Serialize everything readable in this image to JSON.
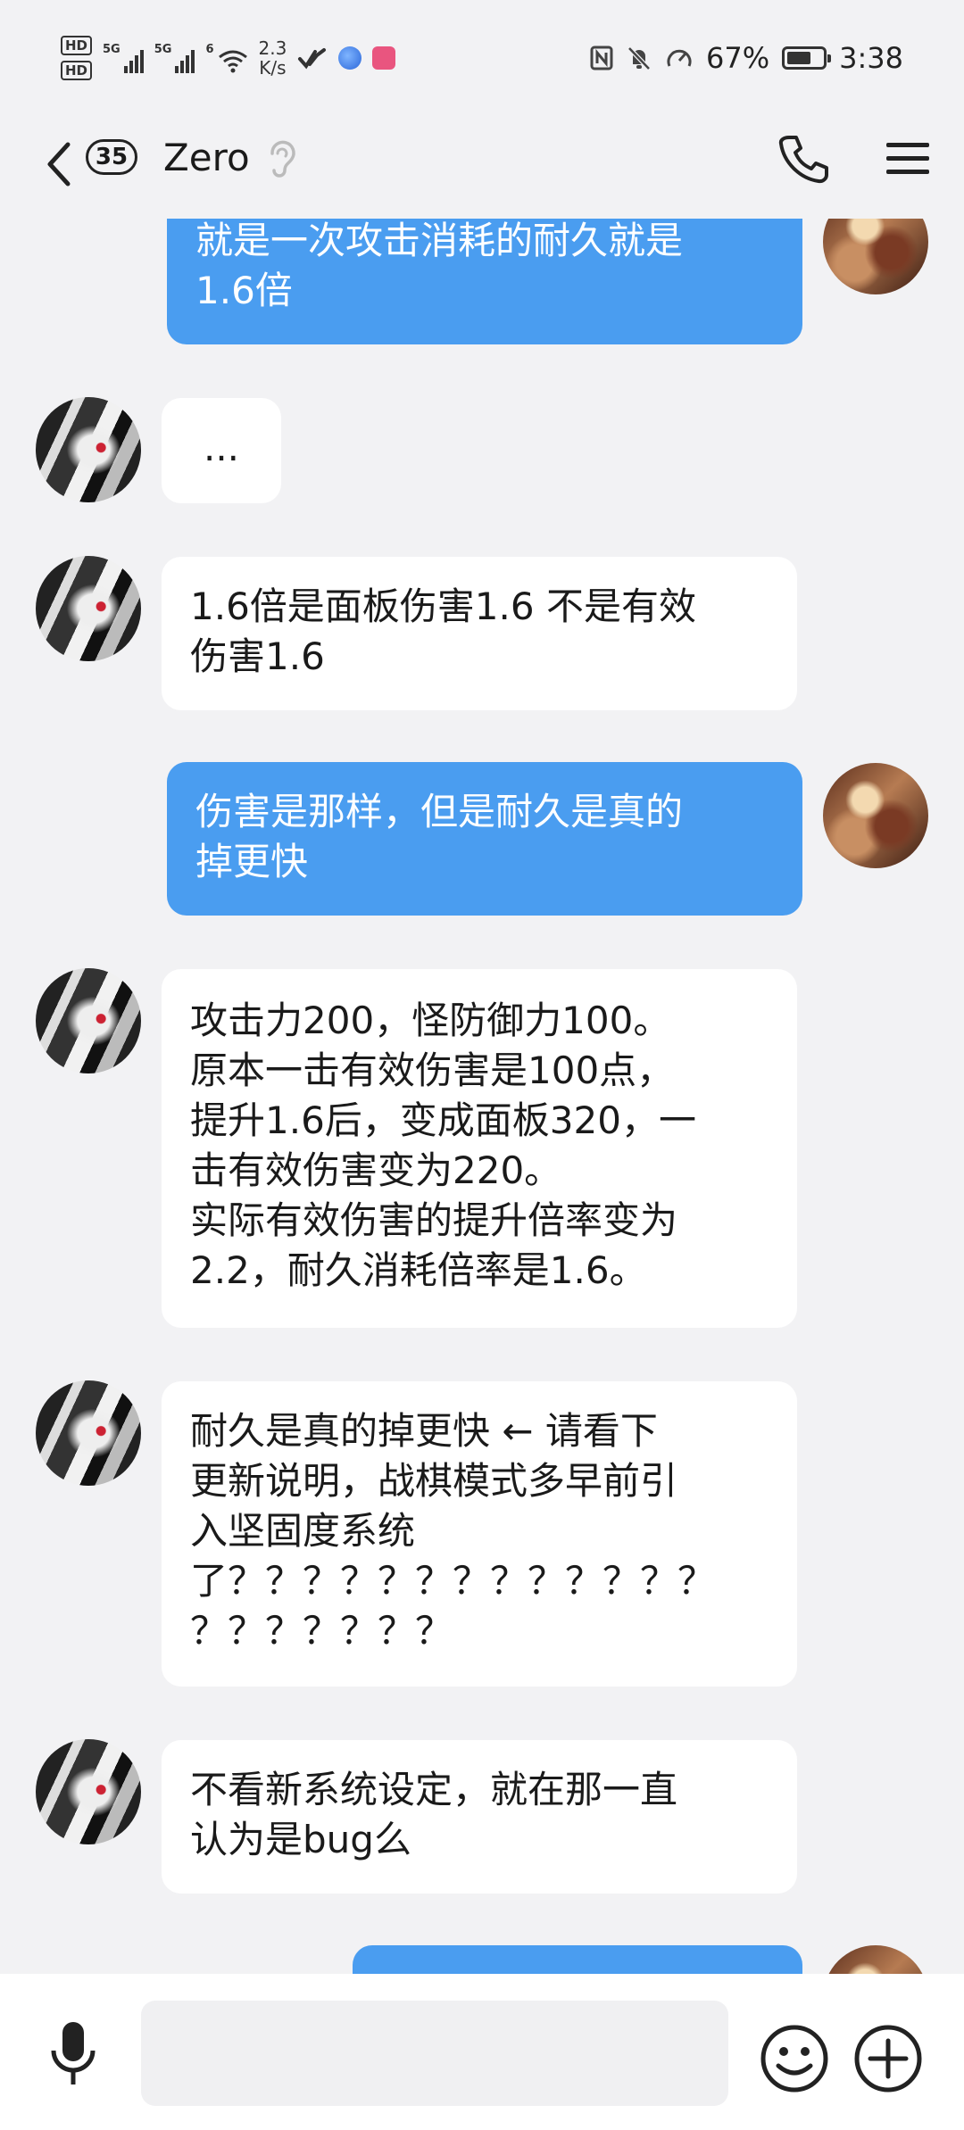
{
  "status_bar": {
    "hd1": "HD",
    "hd2": "HD",
    "sim1": "5G",
    "sim2": "5G",
    "wifi_label": "6",
    "speed_value": "2.3",
    "speed_unit": "K/s",
    "battery_percent": "67%",
    "battery_level": 0.67,
    "time": "3:38",
    "icons": [
      "nfc-icon",
      "mute-bell-icon",
      "speedometer-icon"
    ]
  },
  "header": {
    "unread_count": "35",
    "title": "Zero"
  },
  "messages": [
    {
      "sender": "self",
      "text": "就是一次攻击消耗的耐久就是\n1.6倍"
    },
    {
      "sender": "other",
      "text": "..."
    },
    {
      "sender": "other",
      "text": "1.6倍是面板伤害1.6 不是有效\n伤害1.6"
    },
    {
      "sender": "self",
      "text": "伤害是那样，但是耐久是真的\n掉更快"
    },
    {
      "sender": "other",
      "text": "攻击力200，怪防御力100。\n原本一击有效伤害是100点，\n提升1.6后，变成面板320，一\n击有效伤害变为220。\n实际有效伤害的提升倍率变为\n2.2，耐久消耗倍率是1.6。"
    },
    {
      "sender": "other",
      "text": "耐久是真的掉更快 ← 请看下\n更新说明，战棋模式多早前引\n入坚固度系统\n了？？？？？？？？？？？？？\n？？？？？？？"
    },
    {
      "sender": "other",
      "text": "不看新系统设定，就在那一直\n认为是bug么"
    },
    {
      "sender": "self",
      "text": ""
    }
  ],
  "input": {
    "placeholder": "",
    "value": ""
  },
  "colors": {
    "self_bubble": "#4a9df0",
    "other_bubble": "#ffffff",
    "background": "#f2f2f4"
  }
}
